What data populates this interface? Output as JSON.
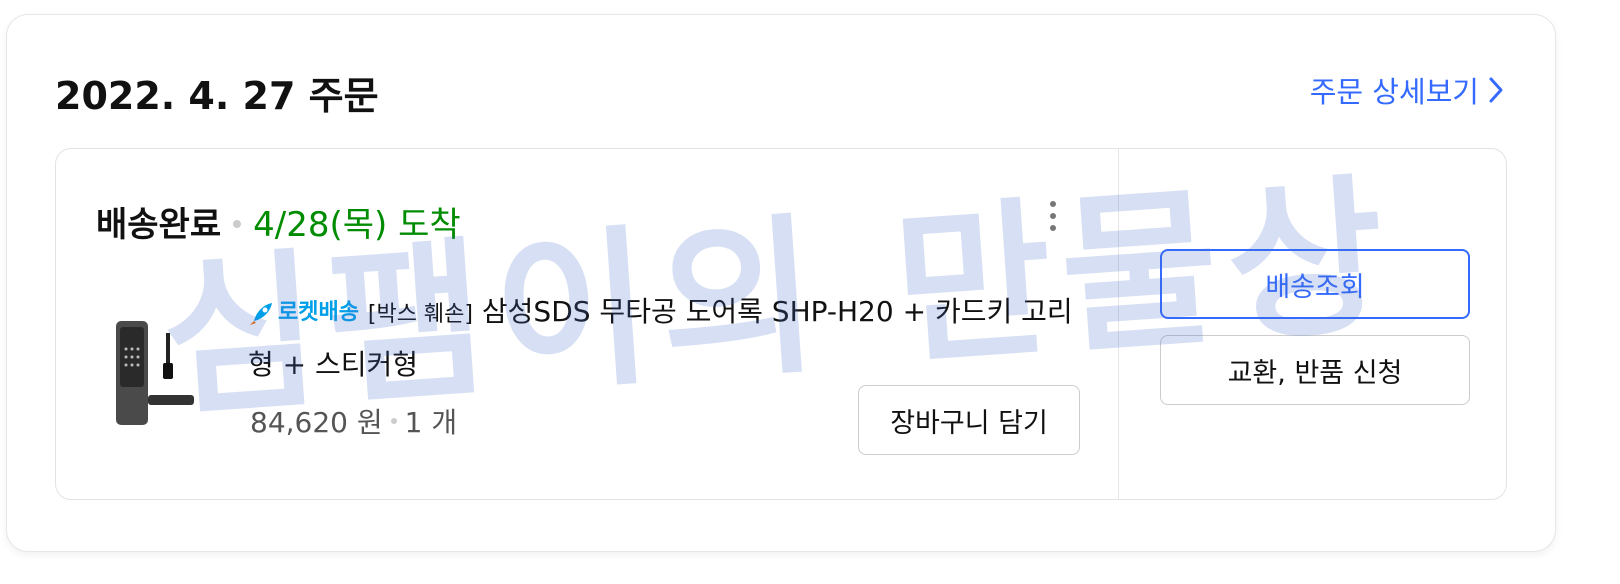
{
  "order": {
    "date_heading": "2022. 4. 27 주문",
    "detail_link_label": "주문 상세보기"
  },
  "shipment": {
    "status": "배송완료",
    "arrival": "4/28(목) 도착"
  },
  "product": {
    "badge_label": "로켓배송",
    "title_prefix": "[박스 훼손]",
    "title": "삼성SDS 무타공 도어록 SHP-H20 + 카드키 고리형 + 스티커형",
    "price": "84,620 원",
    "quantity": "1 개"
  },
  "actions": {
    "cart_label": "장바구니 담기",
    "track_label": "배송조회",
    "return_label": "교환, 반품 신청"
  },
  "watermark_text": "심팸이의 만물상",
  "colors": {
    "accent": "#346aff",
    "arrival_green": "#008c00",
    "rocket_blue": "#00a0e9"
  },
  "icons": {
    "detail": "chevron-right-icon",
    "more": "more-vertical-icon",
    "rocket": "rocket-icon"
  }
}
